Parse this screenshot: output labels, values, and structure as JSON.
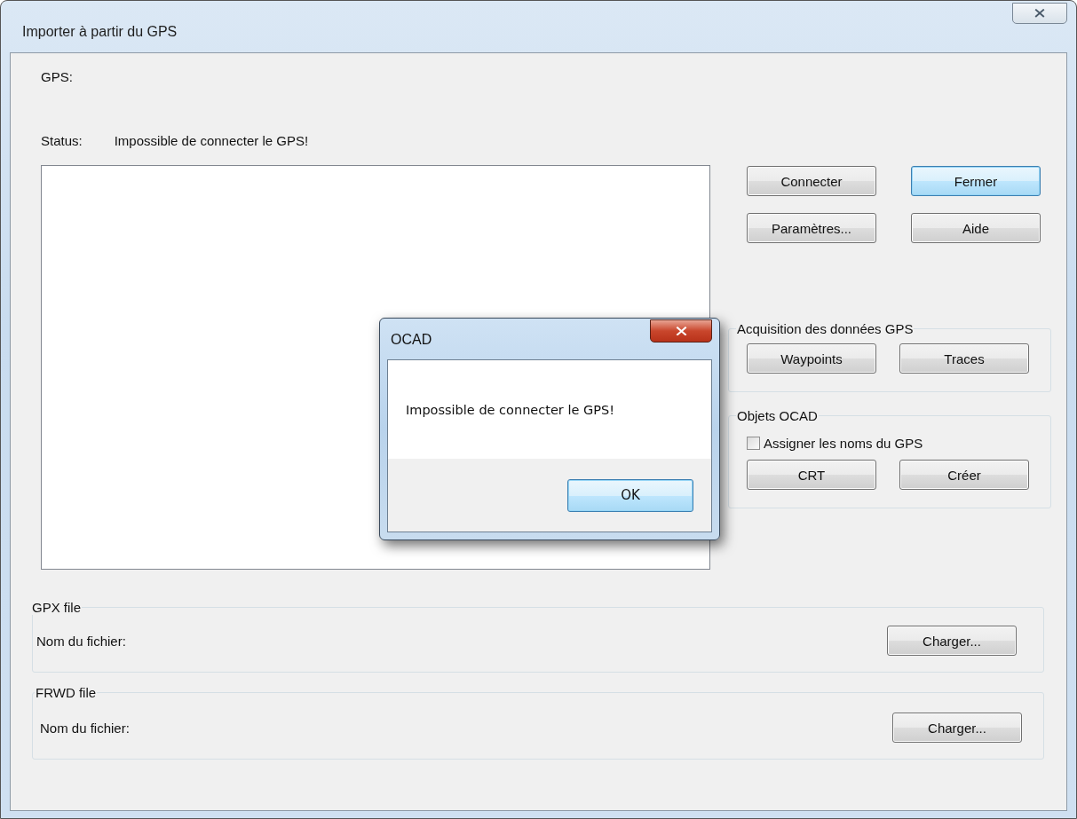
{
  "window": {
    "title": "Importer à partir du GPS"
  },
  "gps": {
    "label": "GPS:"
  },
  "status": {
    "label": "Status:",
    "value": "Impossible de connecter le GPS!"
  },
  "top_buttons": [
    {
      "label": "Connecter",
      "default": false
    },
    {
      "label": "Fermer",
      "default": true
    },
    {
      "label": "Paramètres...",
      "default": false
    },
    {
      "label": "Aide",
      "default": false
    }
  ],
  "acquisition": {
    "title": "Acquisition des données GPS",
    "buttons": [
      "Waypoints",
      "Traces"
    ]
  },
  "objects": {
    "title": "Objets OCAD",
    "checkbox": {
      "label": "Assigner les noms du GPS",
      "checked": false
    },
    "buttons": [
      "CRT",
      "Créer"
    ]
  },
  "file_groups": [
    {
      "title": "GPX file",
      "label": "Nom du fichier:",
      "button": "Charger..."
    },
    {
      "title": "FRWD file",
      "label": "Nom du fichier:",
      "button": "Charger..."
    }
  ],
  "message_box": {
    "title": "OCAD",
    "message": "Impossible de connecter le GPS!",
    "button": "OK"
  }
}
